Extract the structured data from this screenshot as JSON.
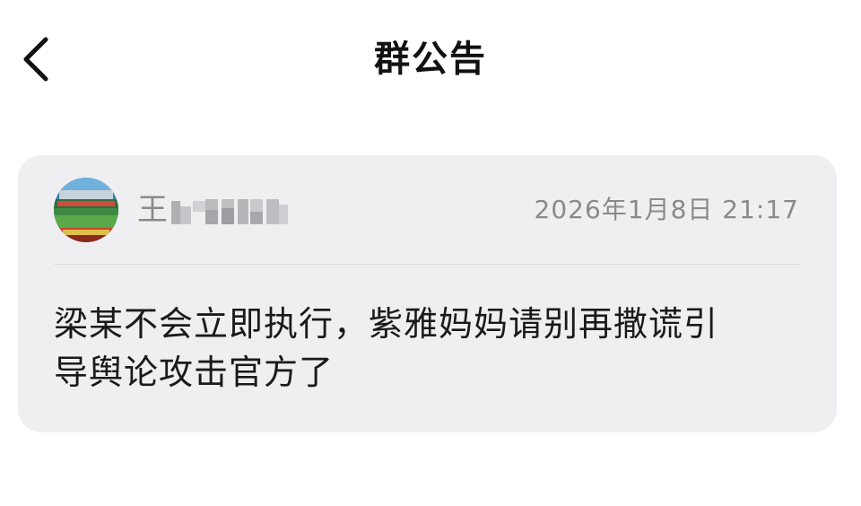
{
  "header": {
    "title": "群公告",
    "back_icon": "chevron-left-icon"
  },
  "announcement": {
    "author": {
      "name_visible": "王",
      "name_obscured": true,
      "avatar": "stadium-photo-avatar"
    },
    "timestamp": "2026年1月8日 21:17",
    "content": "梁某不会立即执行，紫雅妈妈请别再撒谎引\n导舆论攻击官方了"
  },
  "colors": {
    "background": "#ffffff",
    "card_background": "#efeff2",
    "title_text": "#111111",
    "secondary_text": "#8a8a8e",
    "body_text": "#1a1a1a",
    "divider": "#dcdce0"
  }
}
